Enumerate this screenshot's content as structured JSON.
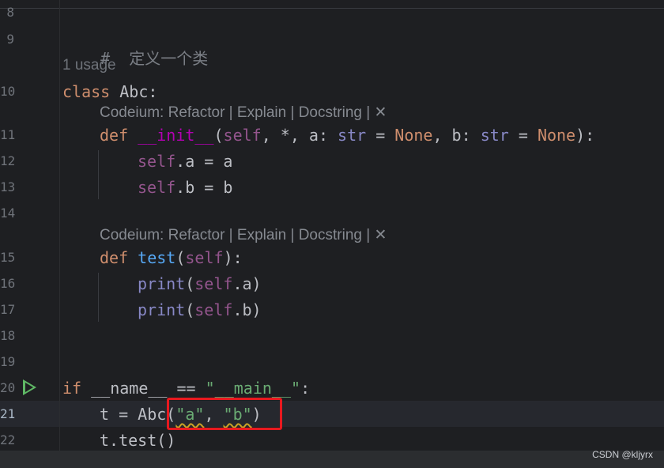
{
  "line_numbers": [
    "8",
    "9",
    "10",
    "11",
    "12",
    "13",
    "14",
    "15",
    "16",
    "17",
    "18",
    "19",
    "20",
    "21",
    "22"
  ],
  "code": {
    "l9_comment": "#  定义一个类",
    "usage_hint": "1 usage",
    "l10_kw": "class",
    "l10_name": " Abc:",
    "codeium_hint": "Codeium: Refactor | Explain | Docstring | ✕",
    "l11": {
      "def": "def",
      "name": "__init__",
      "open": "(",
      "self": "self",
      "mid1": ", *, a: ",
      "str1": "str",
      "eq1": " = ",
      "none1": "None",
      "mid2": ", b: ",
      "str2": "str",
      "eq2": " = ",
      "none2": "None",
      "close": "):"
    },
    "l12": {
      "self": "self",
      "rest": ".a = a"
    },
    "l13": {
      "self": "self",
      "rest": ".b = b"
    },
    "l15": {
      "def": "def",
      "name": "test",
      "open": "(",
      "self": "self",
      "close": "):"
    },
    "l16": {
      "print": "print",
      "open": "(",
      "self": "self",
      "rest": ".a)"
    },
    "l17": {
      "print": "print",
      "open": "(",
      "self": "self",
      "rest": ".b)"
    },
    "l20": {
      "if": "if",
      "rest": " __name__ == ",
      "str": "\"__main__\"",
      "colon": ":"
    },
    "l21": {
      "pre": "t = Abc(",
      "a": "\"a\"",
      "comma": ", ",
      "b": "\"b\"",
      "close": ")"
    },
    "l22": "t.test()"
  },
  "watermark": "CSDN @kljyrx",
  "colors": {
    "highlight_box": "#e8191f",
    "run_icon": "#5fb865"
  }
}
